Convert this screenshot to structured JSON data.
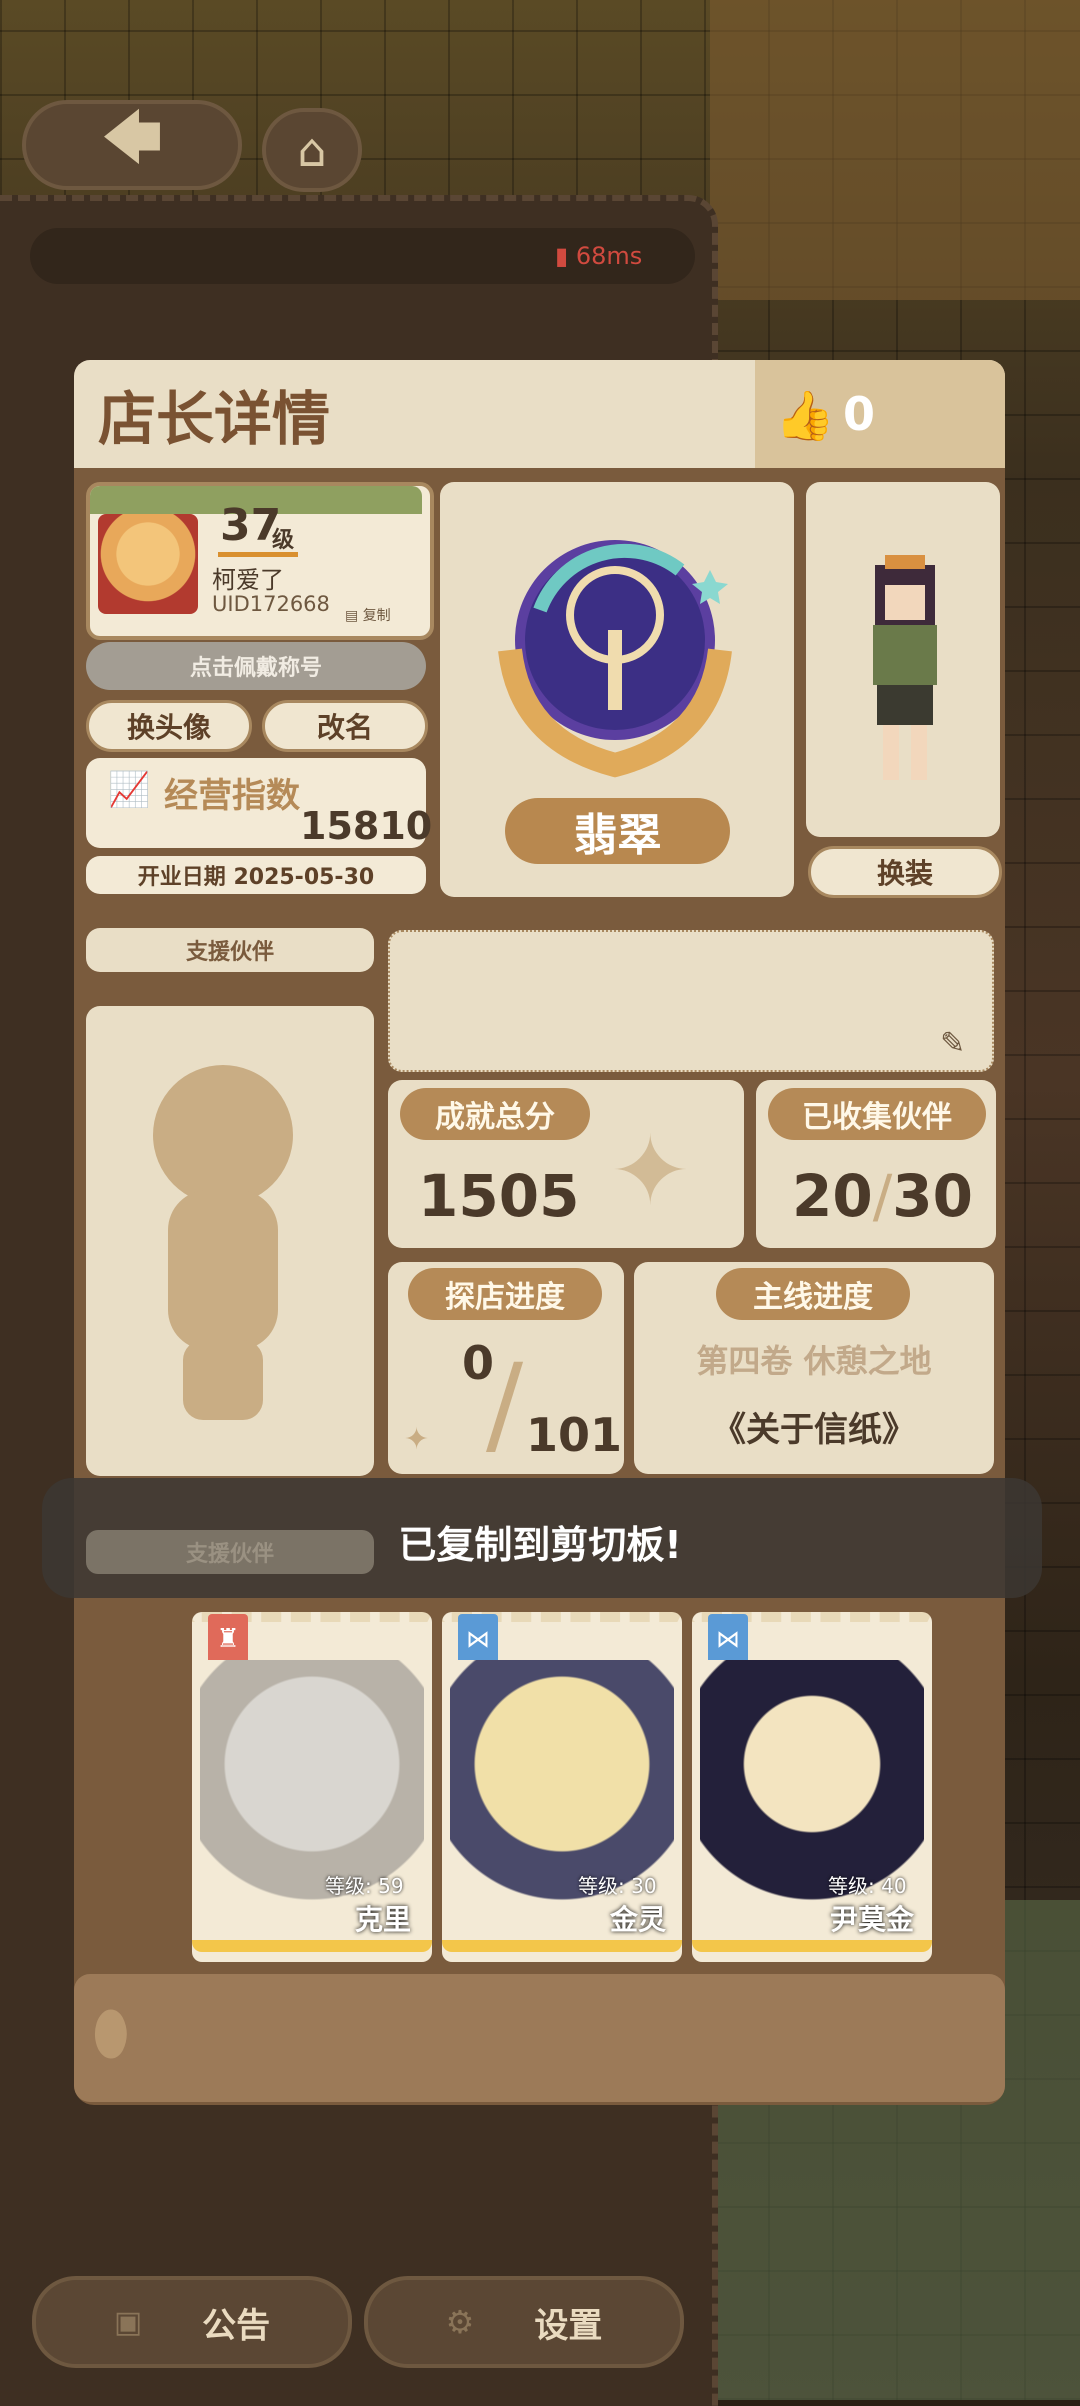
{
  "topbar": {
    "back_icon": "arrow-left-icon",
    "home_icon": "home-icon",
    "ping": "68ms"
  },
  "header": {
    "title": "店长详情",
    "likes": "0"
  },
  "profile": {
    "level": "37",
    "level_unit": "级",
    "name": "柯爱了",
    "uid": "UID172668",
    "copy": "复制",
    "title_button": "点击佩戴称号",
    "change_avatar": "换头像",
    "rename": "改名",
    "business_label": "经营指数",
    "business_value": "15810",
    "open_date": "开业日期 2025-05-30"
  },
  "badge": {
    "rank": "翡翠"
  },
  "outfit": {
    "button": "换装"
  },
  "support": {
    "label": "支援伙伴",
    "label_dim": "支援伙伴"
  },
  "stats": {
    "achievement_label": "成就总分",
    "achievement_value": "1505",
    "collected_label": "已收集伙伴",
    "collected_value": "20",
    "collected_total": "30",
    "explore_label": "探店进度",
    "explore_value": "0",
    "explore_total": "101",
    "story_label": "主线进度",
    "story_volume": "第四卷 休憩之地",
    "story_chapter": "《关于信纸》"
  },
  "toast": "已复制到剪切板!",
  "partners": [
    {
      "name": "克里",
      "level": "等级: 59",
      "role_icon": "chef-hat-icon",
      "color": "#e06a5a"
    },
    {
      "name": "金灵",
      "level": "等级: 30",
      "role_icon": "bow-tie-icon",
      "color": "#5a9ad6"
    },
    {
      "name": "尹莫金",
      "level": "等级: 40",
      "role_icon": "bow-tie-icon",
      "color": "#5a9ad6"
    }
  ],
  "bottom": {
    "announce": "公告",
    "settings": "设置"
  }
}
